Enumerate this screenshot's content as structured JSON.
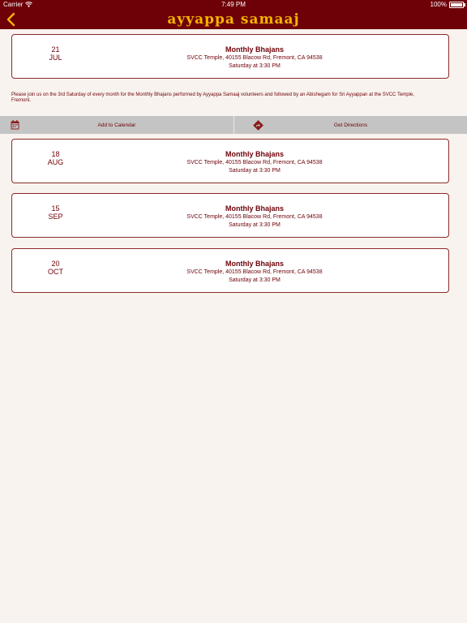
{
  "status_bar": {
    "carrier": "Carrier",
    "time": "7:49 PM",
    "battery": "100%"
  },
  "nav": {
    "title": "ayyappa samaaj",
    "back_icon": "chevron-left-icon"
  },
  "events": [
    {
      "day": "21",
      "month": "JUL",
      "title": "Monthly Bhajans",
      "address": "SVCC Temple, 40155 Blacow Rd, Fremont, CA 94538",
      "time": "Saturday at 3:30 PM"
    },
    {
      "day": "18",
      "month": "AUG",
      "title": "Monthly Bhajans",
      "address": "SVCC Temple, 40155 Blacow Rd, Fremont, CA 94538",
      "time": "Saturday at 3:30 PM"
    },
    {
      "day": "15",
      "month": "SEP",
      "title": "Monthly Bhajans",
      "address": "SVCC Temple, 40155 Blacow Rd, Fremont, CA 94538",
      "time": "Saturday at 3:30 PM"
    },
    {
      "day": "20",
      "month": "OCT",
      "title": "Monthly Bhajans",
      "address": "SVCC Temple, 40155 Blacow Rd, Fremont, CA 94538",
      "time": "Saturday at 3:30 PM"
    }
  ],
  "expanded_event": {
    "description": "Please join us on the 3rd Saturday of every month for the Monthly Bhajans performed by Ayyappa Samaaj volunteers and followed by an Abishegam for Sri Ayyappan at the SVCC Temple, Fremont."
  },
  "actions": {
    "add_to_calendar": "Add to Calendar",
    "get_directions": "Get Directions",
    "calendar_icon": "calendar-icon",
    "directions_icon": "directions-icon"
  },
  "colors": {
    "brand": "#6e0008",
    "title_gold": "#f4b400",
    "background": "#f8f3ee",
    "action_bar": "#c4c4c4"
  }
}
